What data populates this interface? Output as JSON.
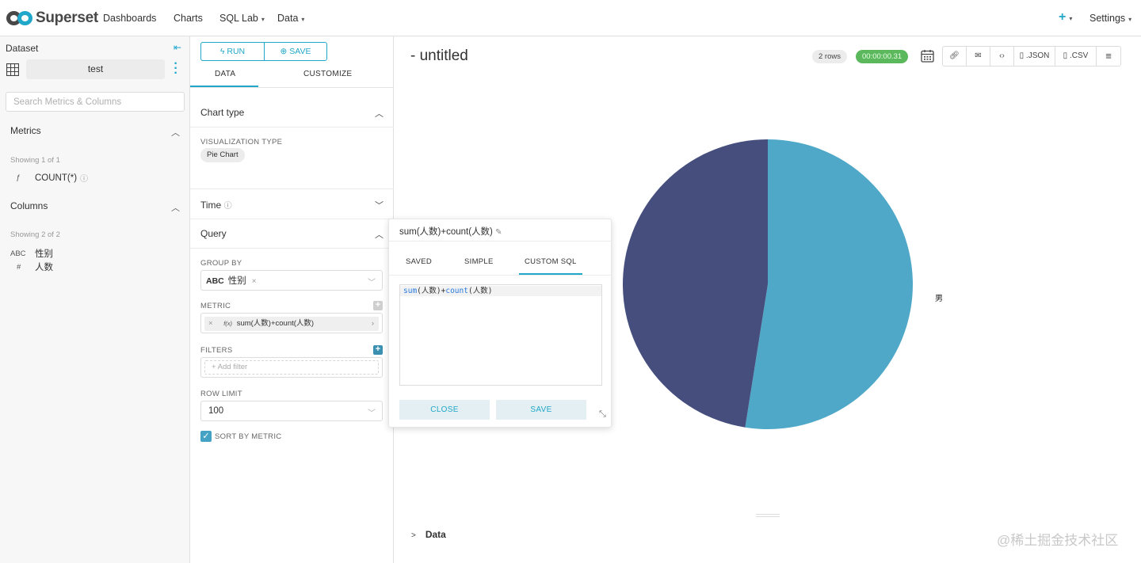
{
  "topnav": {
    "brand": "Superset",
    "items": [
      {
        "label": "Dashboards",
        "caret": false
      },
      {
        "label": "Charts",
        "caret": false
      },
      {
        "label": "SQL Lab",
        "caret": true
      },
      {
        "label": "Data",
        "caret": true
      }
    ],
    "plus": "+",
    "settings": "Settings",
    "caret": "▾"
  },
  "dataset_panel": {
    "title": "Dataset",
    "dataset_name": "test",
    "search_placeholder": "Search Metrics & Columns",
    "metrics": {
      "heading": "Metrics",
      "showing": "Showing 1 of 1",
      "items": [
        {
          "type": "ƒ",
          "name": "COUNT(*)"
        }
      ]
    },
    "columns": {
      "heading": "Columns",
      "showing": "Showing 2 of 2",
      "items": [
        {
          "type": "ABC",
          "name": "性别"
        },
        {
          "type": "#",
          "name": "人数"
        }
      ]
    }
  },
  "control_panel": {
    "run_label": "RUN",
    "save_label": "SAVE",
    "tabs": [
      "DATA",
      "CUSTOMIZE"
    ],
    "chart_type_heading": "Chart type",
    "viz_type_label": "VISUALIZATION TYPE",
    "viz_type_value": "Pie Chart",
    "time_heading": "Time",
    "query_heading": "Query",
    "group_by_label": "GROUP BY",
    "group_by_tag_type": "ABC",
    "group_by_tag_value": "性别",
    "metric_label": "METRIC",
    "metric_fx": "f(x)",
    "metric_value": "sum(人数)+count(人数)",
    "filters_label": "FILTERS",
    "add_filter": "Add filter",
    "row_limit_label": "ROW LIMIT",
    "row_limit_value": "100",
    "sort_by_metric_label": "SORT BY METRIC",
    "sort_by_metric_checked": true
  },
  "chart_panel": {
    "title": "- untitled",
    "rows_badge": "2 rows",
    "time_badge": "00:00:00.31",
    "json_label": ".JSON",
    "csv_label": ".CSV",
    "data_toggle": "Data",
    "watermark": "@稀土掘金技术社区",
    "colors": {
      "slice_a": "#4fa8c8",
      "slice_b": "#454e7c",
      "accent": "#20a7c9",
      "success": "#5cb85c"
    }
  },
  "chart_data": {
    "type": "pie",
    "labels": [
      "男",
      ""
    ],
    "values": [
      52.5,
      47.5
    ],
    "legend": [
      "男"
    ]
  },
  "metric_popover": {
    "title": "sum(人数)+count(人数)",
    "tabs": [
      "SAVED",
      "SIMPLE",
      "CUSTOM SQL"
    ],
    "active_tab": "CUSTOM SQL",
    "sql_fn1": "sum",
    "sql_arg1": "(人数)",
    "sql_plus": "+",
    "sql_fn2": "count",
    "sql_arg2": "(人数)",
    "close_label": "CLOSE",
    "save_label": "SAVE"
  }
}
